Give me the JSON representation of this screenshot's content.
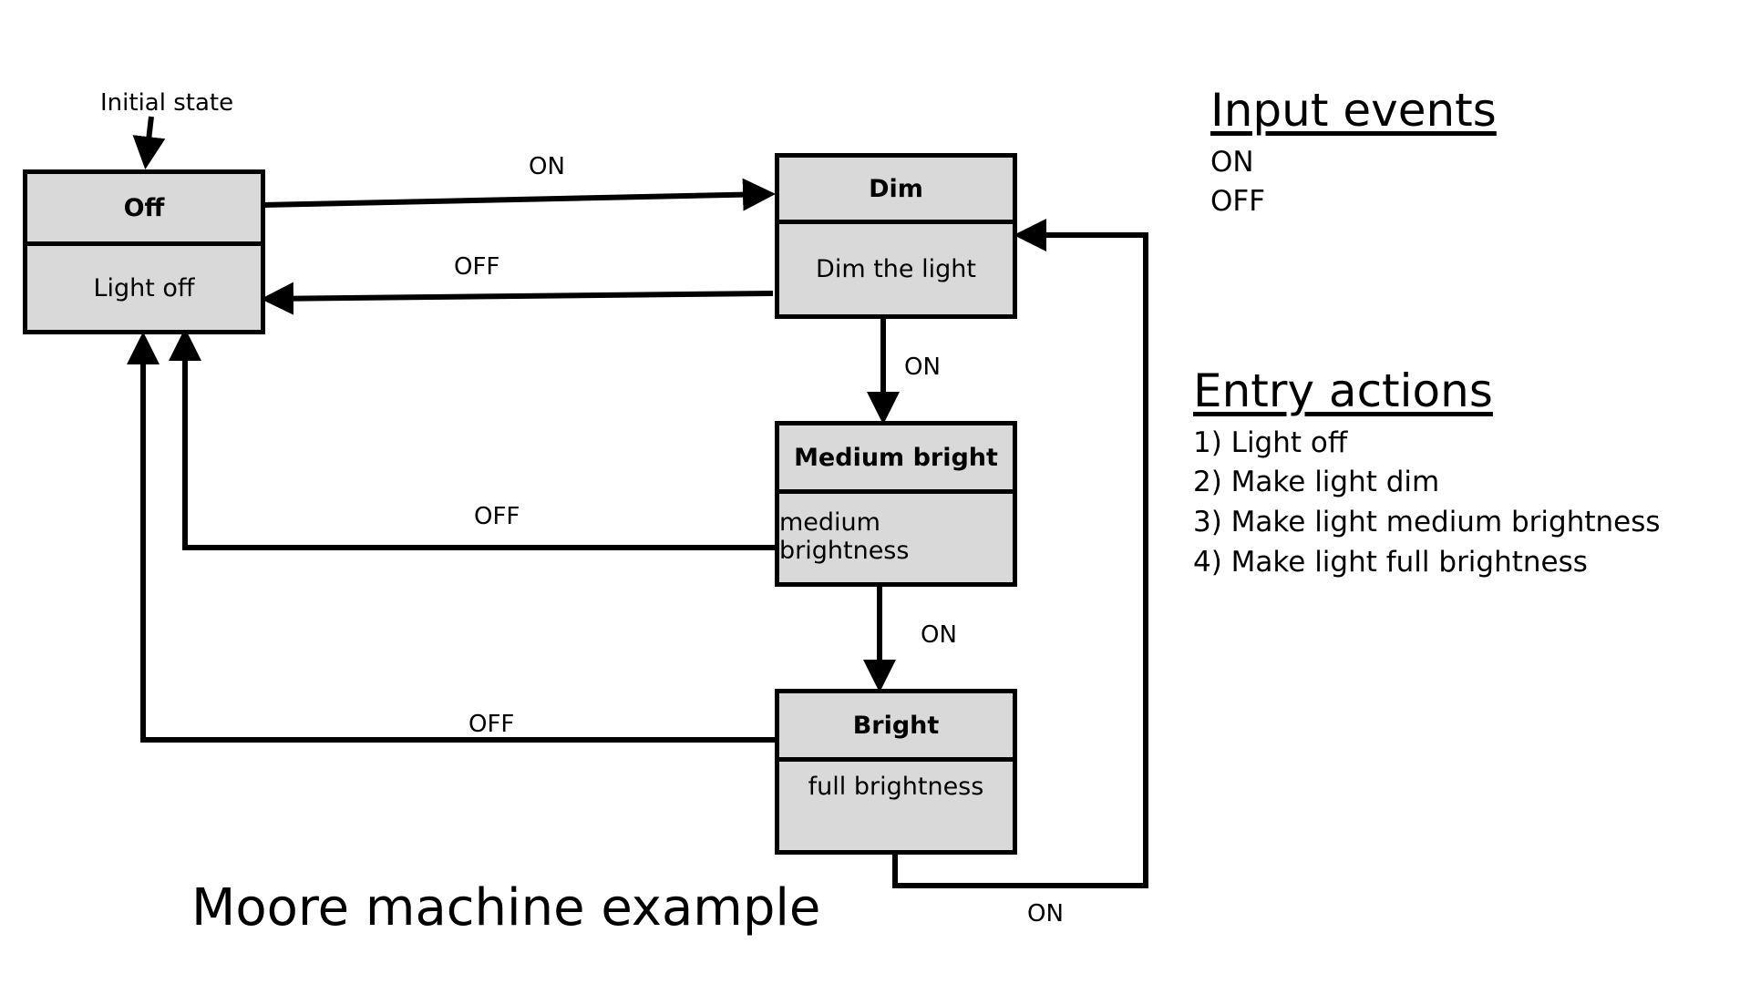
{
  "initial_label": "Initial state",
  "states": [
    {
      "name": "Off",
      "action": "Light off"
    },
    {
      "name": "Dim",
      "action": "Dim the light"
    },
    {
      "name": "Medium bright",
      "action": "medium brightness"
    },
    {
      "name": "Bright",
      "action": "full brightness"
    }
  ],
  "transitions": [
    {
      "from": "Off",
      "to": "Dim",
      "label": "ON"
    },
    {
      "from": "Dim",
      "to": "Off",
      "label": "OFF"
    },
    {
      "from": "Dim",
      "to": "Medium bright",
      "label": "ON"
    },
    {
      "from": "Medium bright",
      "to": "Off",
      "label": "OFF"
    },
    {
      "from": "Medium bright",
      "to": "Bright",
      "label": "ON"
    },
    {
      "from": "Bright",
      "to": "Off",
      "label": "OFF"
    },
    {
      "from": "Bright",
      "to": "Dim",
      "label": "ON"
    }
  ],
  "input_events": {
    "title": "Input events",
    "items": [
      "ON",
      "OFF"
    ]
  },
  "entry_actions": {
    "title": "Entry actions",
    "items": [
      "1) Light off",
      "2) Make light dim",
      "3) Make light medium brightness",
      "4) Make light full brightness"
    ]
  },
  "title": "Moore machine example"
}
